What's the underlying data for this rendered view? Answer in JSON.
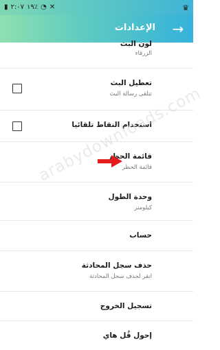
{
  "status_bar": {
    "time": "٢:٠٧",
    "battery": "١٩٪"
  },
  "app_bar": {
    "title": "الإعدادات",
    "back_icon": "arrow-right-icon"
  },
  "settings": [
    {
      "title": "لون البث",
      "subtitle": "الزرقاء"
    },
    {
      "title": "تعطيل البث",
      "subtitle": "تتلقى رسالة البث",
      "checked": false
    },
    {
      "title": "استخدام النقاط تلقائيا",
      "checked": false
    },
    {
      "title": "قائمة الحظر",
      "subtitle": "قائمة الحظر"
    },
    {
      "title": "وحدة الطول",
      "subtitle": "كيلومتر"
    },
    {
      "title": "حساب"
    },
    {
      "title": "حذف سجل المحادثة",
      "subtitle": "انقر لحذف سجل المحادثة"
    },
    {
      "title": "تسجيل الخروج"
    },
    {
      "title": "إحول قُل هاي"
    }
  ],
  "annotation": {
    "arrow_color": "#e31b1b",
    "watermark": "arabydownloads.com"
  },
  "colors": {
    "gradient_start": "#8ee0ae",
    "gradient_end": "#35b2db"
  }
}
